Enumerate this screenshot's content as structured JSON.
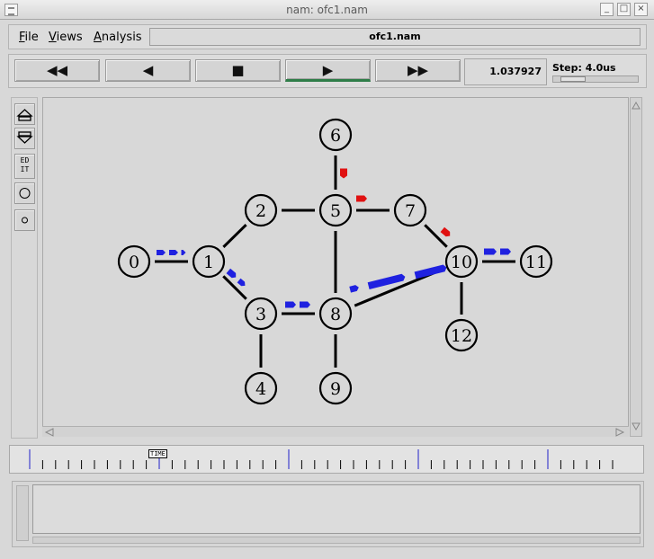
{
  "window": {
    "title": "nam: ofc1.nam"
  },
  "menu": {
    "file": "File",
    "views": "Views",
    "analysis": "Analysis",
    "filename": "ofc1.nam"
  },
  "controls": {
    "rewind": "◀◀",
    "back": "◀",
    "stop": "■",
    "play": "▶",
    "fastforward": "▶▶",
    "time": "1.037927",
    "step": "Step: 4.0us"
  },
  "tools": {
    "edit": "ED\nIT"
  },
  "graph": {
    "nodes": [
      {
        "id": "0"
      },
      {
        "id": "1"
      },
      {
        "id": "2"
      },
      {
        "id": "3"
      },
      {
        "id": "4"
      },
      {
        "id": "5"
      },
      {
        "id": "6"
      },
      {
        "id": "7"
      },
      {
        "id": "8"
      },
      {
        "id": "9"
      },
      {
        "id": "10"
      },
      {
        "id": "11"
      },
      {
        "id": "12"
      }
    ],
    "links": [
      [
        "0",
        "1"
      ],
      [
        "1",
        "2"
      ],
      [
        "1",
        "3"
      ],
      [
        "2",
        "5"
      ],
      [
        "3",
        "4"
      ],
      [
        "3",
        "8"
      ],
      [
        "5",
        "6"
      ],
      [
        "5",
        "7"
      ],
      [
        "5",
        "8"
      ],
      [
        "7",
        "10"
      ],
      [
        "8",
        "9"
      ],
      [
        "8",
        "10"
      ],
      [
        "10",
        "11"
      ],
      [
        "10",
        "12"
      ]
    ],
    "packet_colors": {
      "blue": "#1f21e0",
      "red": "#e01111"
    }
  },
  "timeline": {
    "label": "TIME"
  }
}
